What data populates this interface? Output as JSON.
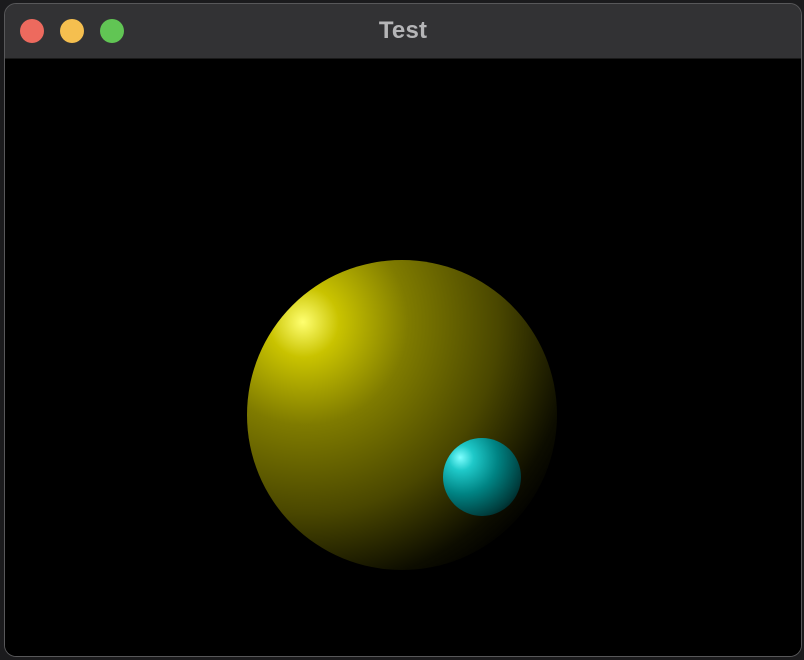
{
  "window": {
    "title": "Test"
  },
  "controls": {
    "close": {
      "icon": "close-icon",
      "color": "#ed6a5e"
    },
    "minimize": {
      "icon": "minimize-icon",
      "color": "#f5bf4f"
    },
    "zoom": {
      "icon": "zoom-icon",
      "color": "#61c554"
    }
  },
  "scene": {
    "background": "#000000",
    "objects": [
      {
        "name": "large-sphere",
        "color": "#7a7a00",
        "highlight": "#ffff66"
      },
      {
        "name": "small-sphere",
        "color": "#008b8b",
        "highlight": "#66ffff"
      }
    ]
  }
}
